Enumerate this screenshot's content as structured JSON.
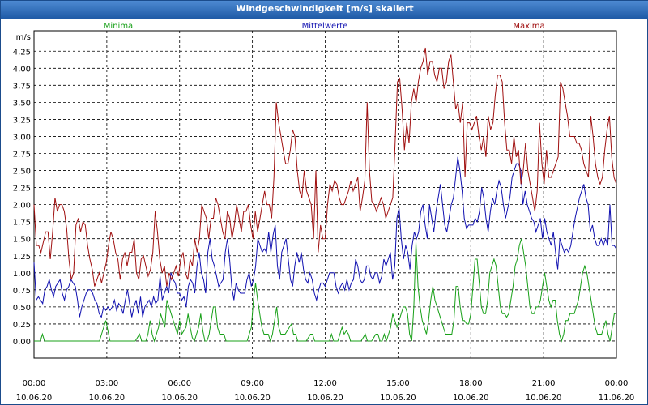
{
  "window_title": "Windgeschwindigkeit [m/s] skaliert",
  "chart_data": {
    "type": "line",
    "title": "Windgeschwindigkeit [m/s] skaliert",
    "ylabel": "m/s",
    "ylim": [
      -0.25,
      4.55
    ],
    "xlim": [
      0,
      24
    ],
    "grid": true,
    "y_ticks": [
      "0,00",
      "0,25",
      "0,50",
      "0,75",
      "1,00",
      "1,25",
      "1,50",
      "1,75",
      "2,00",
      "2,25",
      "2,50",
      "2,75",
      "3,00",
      "3,25",
      "3,50",
      "3,75",
      "4,00",
      "4,25"
    ],
    "x_ticks": [
      {
        "time": "00:00",
        "date": "10.06.20"
      },
      {
        "time": "03:00",
        "date": "10.06.20"
      },
      {
        "time": "06:00",
        "date": "10.06.20"
      },
      {
        "time": "09:00",
        "date": "10.06.20"
      },
      {
        "time": "12:00",
        "date": "10.06.20"
      },
      {
        "time": "15:00",
        "date": "10.06.20"
      },
      {
        "time": "18:00",
        "date": "10.06.20"
      },
      {
        "time": "21:00",
        "date": "10.06.20"
      },
      {
        "time": "00:00",
        "date": "11.06.20"
      }
    ],
    "series": [
      {
        "name": "Minima",
        "color": "#18a018",
        "values": [
          0,
          0,
          0,
          0,
          0.1,
          0,
          0,
          0,
          0,
          0,
          0,
          0,
          0,
          0,
          0,
          0,
          0,
          0,
          0,
          0,
          0,
          0,
          0,
          0,
          0,
          0,
          0,
          0,
          0,
          0,
          0,
          0,
          0.1,
          0.2,
          0.3,
          0.15,
          0,
          0,
          0,
          0,
          0,
          0,
          0,
          0,
          0,
          0,
          0,
          0,
          0,
          0.05,
          0.1,
          0,
          0,
          0,
          0.1,
          0.3,
          0.1,
          0,
          0.1,
          0.2,
          0.4,
          0.3,
          0.2,
          0.6,
          0.5,
          0.4,
          0.3,
          0.2,
          0.1,
          0.3,
          0.1,
          0.15,
          0.2,
          0.4,
          0.2,
          0.05,
          0,
          0.1,
          0.2,
          0.4,
          0.15,
          0,
          0,
          0.1,
          0.3,
          0.5,
          0.5,
          0.2,
          0.1,
          0.1,
          0.1,
          0,
          0,
          0,
          0,
          0,
          0,
          0,
          0,
          0,
          0,
          0,
          0.1,
          0.2,
          0.6,
          0.85,
          0.6,
          0.4,
          0.2,
          0.1,
          0.1,
          0.1,
          0,
          0.1,
          0.3,
          0.5,
          0.2,
          0.1,
          0.1,
          0.1,
          0.15,
          0.2,
          0.25,
          0.1,
          0.1,
          0,
          0,
          0,
          0,
          0,
          0.05,
          0.1,
          0.1,
          0,
          0,
          0,
          0,
          0,
          0,
          0,
          0,
          0.1,
          0,
          0,
          0,
          0.1,
          0.2,
          0.1,
          0.15,
          0.1,
          0,
          0,
          0,
          0,
          0,
          0,
          0.05,
          0.1,
          0,
          0,
          0,
          0.05,
          0.1,
          0.1,
          0,
          0,
          0.1,
          0,
          0.1,
          0.2,
          0.4,
          0.3,
          0.2,
          0.3,
          0.4,
          0.5,
          0.5,
          0.4,
          0.1,
          0,
          0.5,
          1.45,
          0.8,
          0.5,
          0.3,
          0.2,
          0.1,
          0.3,
          0.6,
          0.8,
          0.6,
          0.5,
          0.4,
          0.3,
          0.2,
          0.1,
          0.1,
          0.1,
          0.1,
          0.3,
          0.8,
          0.8,
          0.5,
          0.3,
          0.3,
          0.25,
          0.25,
          0.4,
          0.8,
          1.2,
          1.2,
          0.85,
          0.5,
          0.4,
          0.4,
          0.6,
          1,
          1.1,
          1.2,
          1.1,
          0.8,
          0.5,
          0.4,
          0.4,
          0.35,
          0.4,
          0.6,
          0.8,
          1.1,
          1.2,
          1.4,
          1.5,
          1.3,
          1.1,
          0.8,
          0.5,
          0.4,
          0.4,
          0.5,
          0.5,
          0.6,
          0.8,
          1,
          0.8,
          0.6,
          0.5,
          0.6,
          0.6,
          0.3,
          0.1,
          0,
          0.1,
          0.3,
          0.3,
          0.4,
          0.4,
          0.4,
          0.5,
          0.6,
          0.8,
          1,
          1.1,
          1,
          0.8,
          0.6,
          0.4,
          0.2,
          0.1,
          0.1,
          0.1,
          0.2,
          0.3,
          0.1,
          0,
          0.2,
          0.4,
          0.4
        ]
      },
      {
        "name": "Mittelwerte",
        "color": "#1010b0",
        "values": [
          1.15,
          0.6,
          0.65,
          0.6,
          0.55,
          0.75,
          0.8,
          0.9,
          0.75,
          0.65,
          0.8,
          0.85,
          0.9,
          0.7,
          0.6,
          0.75,
          0.8,
          0.9,
          0.85,
          0.8,
          0.6,
          0.35,
          0.5,
          0.6,
          0.7,
          0.75,
          0.75,
          0.7,
          0.6,
          0.55,
          0.4,
          0.35,
          0.5,
          0.45,
          0.5,
          0.45,
          0.5,
          0.6,
          0.45,
          0.55,
          0.5,
          0.4,
          0.6,
          0.75,
          0.55,
          0.35,
          0.5,
          0.6,
          0.4,
          0.65,
          0.35,
          0.5,
          0.55,
          0.6,
          0.5,
          0.65,
          0.55,
          0.6,
          0.95,
          0.6,
          0.7,
          0.8,
          0.7,
          1,
          0.9,
          0.85,
          0.7,
          0.7,
          0.6,
          0.65,
          0.5,
          0.8,
          0.9,
          0.85,
          0.7,
          1.1,
          1.3,
          1,
          0.9,
          0.7,
          1.3,
          1.5,
          1.2,
          1.1,
          0.95,
          0.8,
          0.85,
          0.9,
          1.3,
          1.5,
          1.2,
          0.8,
          0.6,
          0.85,
          0.75,
          0.7,
          0.7,
          0.7,
          0.9,
          1,
          0.8,
          0.9,
          1.1,
          1.5,
          1.4,
          1.3,
          1.35,
          1.3,
          1.6,
          1.3,
          1.55,
          1.7,
          1.1,
          0.9,
          1.3,
          1.4,
          1.5,
          1.2,
          0.9,
          0.8,
          1.1,
          1.3,
          1.15,
          1.3,
          1.05,
          0.9,
          0.85,
          1,
          0.9,
          0.7,
          0.6,
          0.75,
          0.85,
          0.85,
          0.8,
          0.9,
          1,
          1,
          1,
          0.8,
          0.7,
          0.8,
          0.85,
          0.75,
          0.9,
          0.75,
          0.85,
          0.9,
          1.2,
          1.1,
          0.9,
          0.85,
          0.9,
          1.1,
          1.1,
          0.95,
          0.9,
          1,
          1,
          0.85,
          0.95,
          1.2,
          1.1,
          1.2,
          1.3,
          0.9,
          1.1,
          1.8,
          1.95,
          1.5,
          1.2,
          1.4,
          1.3,
          1.05,
          1.4,
          1.6,
          1.5,
          1.6,
          1.9,
          2,
          1.7,
          1.5,
          2,
          1.8,
          1.6,
          1.9,
          2.1,
          2.3,
          2,
          1.7,
          1.6,
          1.8,
          2,
          2.1,
          2.4,
          2.7,
          2.5,
          2.2,
          1.8,
          1.65,
          1.7,
          1.7,
          1.7,
          1.8,
          1.75,
          1.9,
          2.25,
          2.1,
          1.8,
          1.6,
          1.9,
          2.1,
          2,
          2.2,
          2.35,
          2.25,
          2,
          1.8,
          1.95,
          2.1,
          2.4,
          2.5,
          2.6,
          2.6,
          2.5,
          2,
          2.2,
          2,
          1.9,
          1.8,
          1.75,
          1.6,
          1.7,
          1.8,
          1.5,
          1.8,
          1.6,
          1.5,
          1.4,
          1.6,
          1.3,
          1.05,
          1.5,
          1.4,
          1.3,
          1.35,
          1.3,
          1.4,
          1.6,
          1.8,
          1.95,
          2.1,
          2.2,
          2.3,
          2.1,
          2,
          1.6,
          1.7,
          1.5,
          1.4,
          1.4,
          1.5,
          1.4,
          1.5,
          1.4,
          2,
          1.4,
          1.4,
          1.35
        ]
      },
      {
        "name": "Maxima",
        "color": "#a01010",
        "values": [
          2,
          1.4,
          1.4,
          1.3,
          1.45,
          1.6,
          1.6,
          1.2,
          1.6,
          2.1,
          1.9,
          2,
          2,
          1.9,
          1.65,
          1.2,
          0.9,
          1,
          1.7,
          1.8,
          1.6,
          1.75,
          1.7,
          1.4,
          1.2,
          1.05,
          0.8,
          0.9,
          1,
          0.85,
          1,
          1.15,
          1.4,
          1.6,
          1.5,
          1.3,
          1.2,
          0.9,
          1.2,
          1.3,
          1.1,
          1.3,
          1.3,
          1.5,
          1,
          0.9,
          1.2,
          1.25,
          1.1,
          0.95,
          1.05,
          1.3,
          1.9,
          1.6,
          1.2,
          1,
          1.1,
          0.8,
          1,
          0.9,
          1,
          1.1,
          0.95,
          1.2,
          1.3,
          1,
          0.9,
          1.2,
          1.1,
          1.5,
          1.3,
          1.5,
          2,
          1.9,
          1.8,
          1.5,
          1.8,
          1.8,
          2.1,
          2,
          1.8,
          1.6,
          1.5,
          1.9,
          1.8,
          1.5,
          1.7,
          2,
          1.8,
          1.6,
          1.9,
          1.9,
          2,
          1.7,
          1.5,
          1.9,
          1.6,
          1.8,
          2,
          2.2,
          2,
          2,
          1.8,
          2.4,
          3.5,
          3.2,
          3,
          2.8,
          2.6,
          2.6,
          2.8,
          3.1,
          3,
          2.5,
          2.2,
          2.1,
          2.5,
          2.2,
          2.1,
          2,
          1.5,
          2.5,
          1.3,
          1.7,
          1.5,
          1.5,
          2,
          2.3,
          2.2,
          2.35,
          2.3,
          2.1,
          2,
          2,
          2.1,
          2.2,
          2.35,
          2.2,
          2.3,
          2.4,
          1.9,
          2.1,
          2.35,
          3.5,
          2.5,
          2.05,
          2,
          1.9,
          2,
          2.1,
          2,
          1.8,
          1.9,
          2,
          2.1,
          2.9,
          3.8,
          3.85,
          3.4,
          2.8,
          3.2,
          2.9,
          3.5,
          3.7,
          3.5,
          3.8,
          4,
          4.1,
          4.3,
          3.9,
          4.1,
          4.1,
          3.9,
          3.8,
          4,
          4,
          3.7,
          3.8,
          4.1,
          4.2,
          3.8,
          3.4,
          3.5,
          3.2,
          3.5,
          2.4,
          3.2,
          3.2,
          3.1,
          3.2,
          3.3,
          3,
          2.8,
          3,
          2.7,
          3.3,
          3.1,
          3.2,
          3.6,
          3.9,
          3.9,
          3.8,
          3.2,
          2.8,
          2.8,
          2.6,
          3,
          2.7,
          2.8,
          2.3,
          2.5,
          2.9,
          2.5,
          2.3,
          2.1,
          1.9,
          2.2,
          3.2,
          2.6,
          2.3,
          2.8,
          2.4,
          2.4,
          2.5,
          2.6,
          2.7,
          3.8,
          3.7,
          3.5,
          3.3,
          3,
          3,
          3,
          2.9,
          2.9,
          2.8,
          2.6,
          2.5,
          2.4,
          3.3,
          3,
          2.6,
          2.4,
          2.3,
          2.4,
          2.8,
          3.1,
          3.3,
          2.7,
          2.4,
          2.3
        ]
      }
    ]
  }
}
